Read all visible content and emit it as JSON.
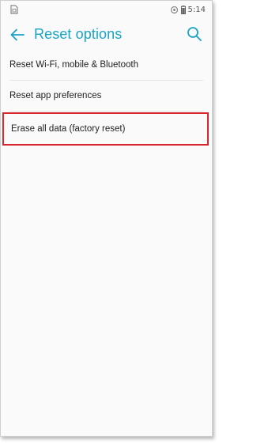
{
  "status_bar": {
    "time": "5:14"
  },
  "header": {
    "title": "Reset options",
    "back_icon": "arrow-back-icon",
    "search_icon": "search-icon"
  },
  "options": [
    {
      "label": "Reset Wi-Fi, mobile & Bluetooth"
    },
    {
      "label": "Reset app preferences"
    },
    {
      "label": "Erase all data (factory reset)",
      "highlighted": true
    }
  ],
  "colors": {
    "accent": "#1aa3c3",
    "highlight_border": "#d7262e",
    "background": "#fafafa",
    "text": "#222222"
  }
}
